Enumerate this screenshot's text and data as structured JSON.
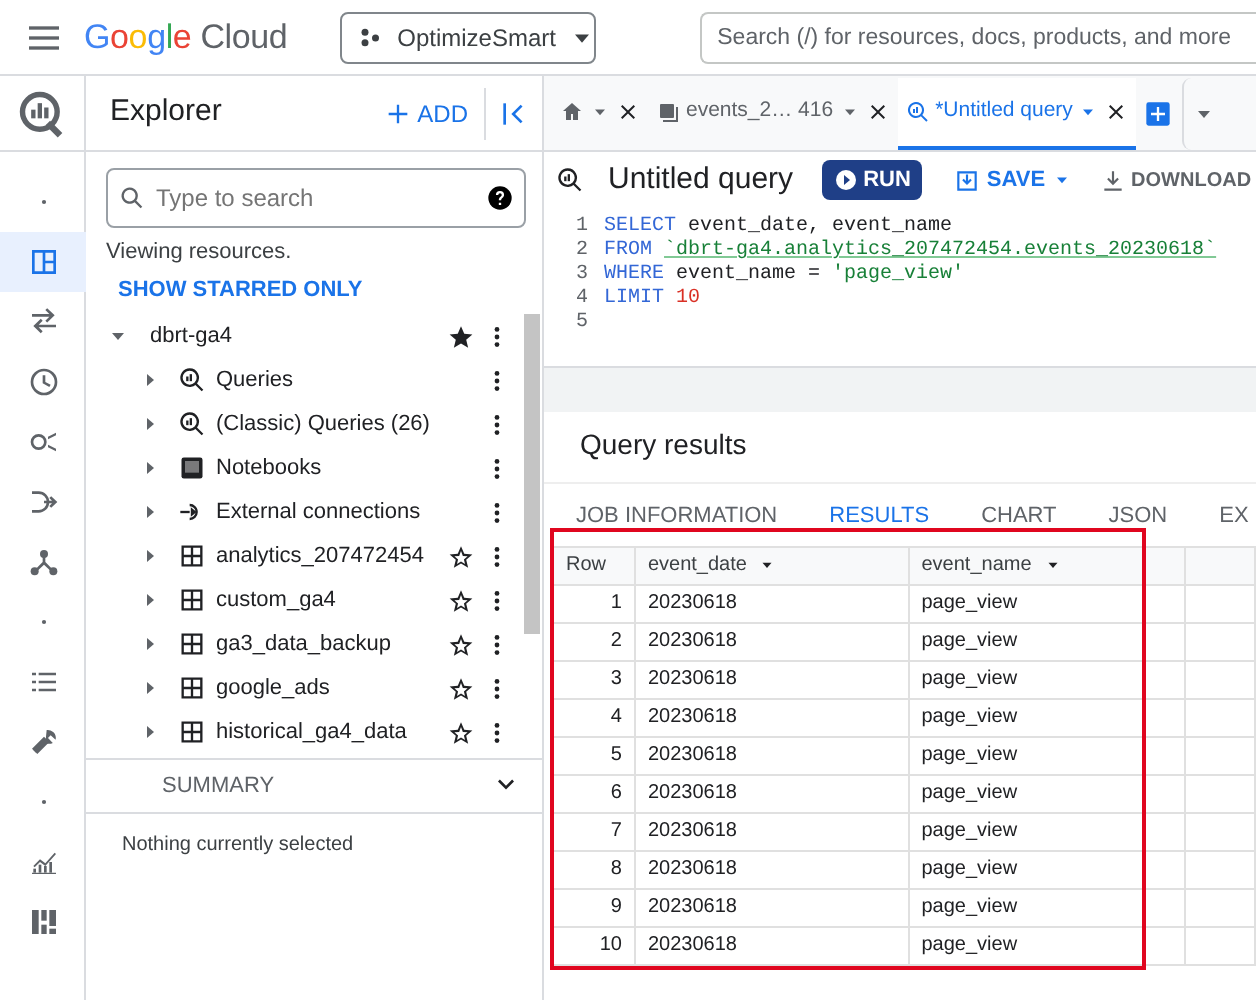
{
  "topbar": {
    "logo_colored": "Google",
    "logo_plain": "Cloud",
    "project": "OptimizeSmart",
    "search": {
      "placeholder": "Search (/) for resources, docs, products, and more"
    }
  },
  "rail": [
    {
      "kind": "dot",
      "selected": false
    },
    {
      "kind": "panels",
      "selected": true
    },
    {
      "kind": "transfer",
      "selected": false
    },
    {
      "kind": "clock",
      "selected": false
    },
    {
      "kind": "lens",
      "selected": false
    },
    {
      "kind": "pipeline",
      "selected": false
    },
    {
      "kind": "hub",
      "selected": false
    },
    {
      "kind": "dot",
      "selected": false
    },
    {
      "kind": "list",
      "selected": false
    },
    {
      "kind": "wrench",
      "selected": false
    },
    {
      "kind": "dot",
      "selected": false
    },
    {
      "kind": "chart",
      "selected": false
    },
    {
      "kind": "grid",
      "selected": false
    }
  ],
  "explorer": {
    "title": "Explorer",
    "add": "ADD",
    "search": {
      "placeholder": "Type to search"
    },
    "status": "Viewing resources.",
    "starred_link": "SHOW STARRED ONLY",
    "tree": [
      {
        "label": "dbrt-ga4",
        "expanded": true,
        "starred": true,
        "children": [
          {
            "label": "Queries",
            "kind": "query",
            "expanded": false
          },
          {
            "label": "(Classic) Queries (26)",
            "kind": "query",
            "expanded": false
          },
          {
            "label": "Notebooks",
            "kind": "notebook",
            "expanded": false
          },
          {
            "label": "External connections",
            "kind": "connection",
            "expanded": false
          },
          {
            "label": "analytics_207472454",
            "kind": "dataset",
            "expanded": false,
            "starred": false
          },
          {
            "label": "custom_ga4",
            "kind": "dataset",
            "expanded": false,
            "starred": false
          },
          {
            "label": "ga3_data_backup",
            "kind": "dataset",
            "expanded": false,
            "starred": false
          },
          {
            "label": "google_ads",
            "kind": "dataset",
            "expanded": false,
            "starred": false
          },
          {
            "label": "historical_ga4_data",
            "kind": "dataset",
            "expanded": false,
            "starred": false
          }
        ]
      }
    ],
    "summary": {
      "title": "SUMMARY",
      "expanded": false,
      "text": "Nothing currently selected"
    }
  },
  "tabs": [
    {
      "kind": "home",
      "selected": false
    },
    {
      "kind": "table",
      "label": "events_2… 416",
      "selected": false
    },
    {
      "kind": "query",
      "label": "*Untitled query",
      "selected": true
    }
  ],
  "query": {
    "title": "Untitled query",
    "run": "RUN",
    "save": "SAVE",
    "download": "DOWNLOAD",
    "lines": [
      {
        "num": "1",
        "tokens": [
          {
            "kind": "keyword",
            "text": "SELECT"
          },
          {
            "kind": "plain",
            "text": "event_date, event_name"
          }
        ]
      },
      {
        "num": "2",
        "tokens": [
          {
            "kind": "keyword",
            "text": "FROM"
          },
          {
            "kind": "table",
            "text": "`dbrt-ga4.analytics_207472454.events_20230618`"
          }
        ]
      },
      {
        "num": "3",
        "tokens": [
          {
            "kind": "keyword",
            "text": "WHERE"
          },
          {
            "kind": "plain",
            "text": "event_name ="
          },
          {
            "kind": "string",
            "text": "'page_view'"
          }
        ]
      },
      {
        "num": "4",
        "tokens": [
          {
            "kind": "keyword",
            "text": "LIMIT"
          },
          {
            "kind": "number",
            "text": "10"
          }
        ]
      },
      {
        "num": "5"
      }
    ]
  },
  "results": {
    "title": "Query results",
    "tabs": [
      {
        "label": "JOB INFORMATION",
        "selected": false
      },
      {
        "label": "RESULTS",
        "selected": true
      },
      {
        "label": "CHART",
        "selected": false
      },
      {
        "label": "JSON",
        "selected": false
      },
      {
        "label": "EX",
        "selected": false
      }
    ],
    "columns": [
      {
        "label": "Row",
        "menu": false
      },
      {
        "label": "event_date",
        "menu": true
      },
      {
        "label": "event_name",
        "menu": true
      }
    ],
    "rows": [
      [
        "1",
        "20230618",
        "page_view"
      ],
      [
        "2",
        "20230618",
        "page_view"
      ],
      [
        "3",
        "20230618",
        "page_view"
      ],
      [
        "4",
        "20230618",
        "page_view"
      ],
      [
        "5",
        "20230618",
        "page_view"
      ],
      [
        "6",
        "20230618",
        "page_view"
      ],
      [
        "7",
        "20230618",
        "page_view"
      ],
      [
        "8",
        "20230618",
        "page_view"
      ],
      [
        "9",
        "20230618",
        "page_view"
      ],
      [
        "10",
        "20230618",
        "page_view"
      ]
    ],
    "highlighted": true
  }
}
